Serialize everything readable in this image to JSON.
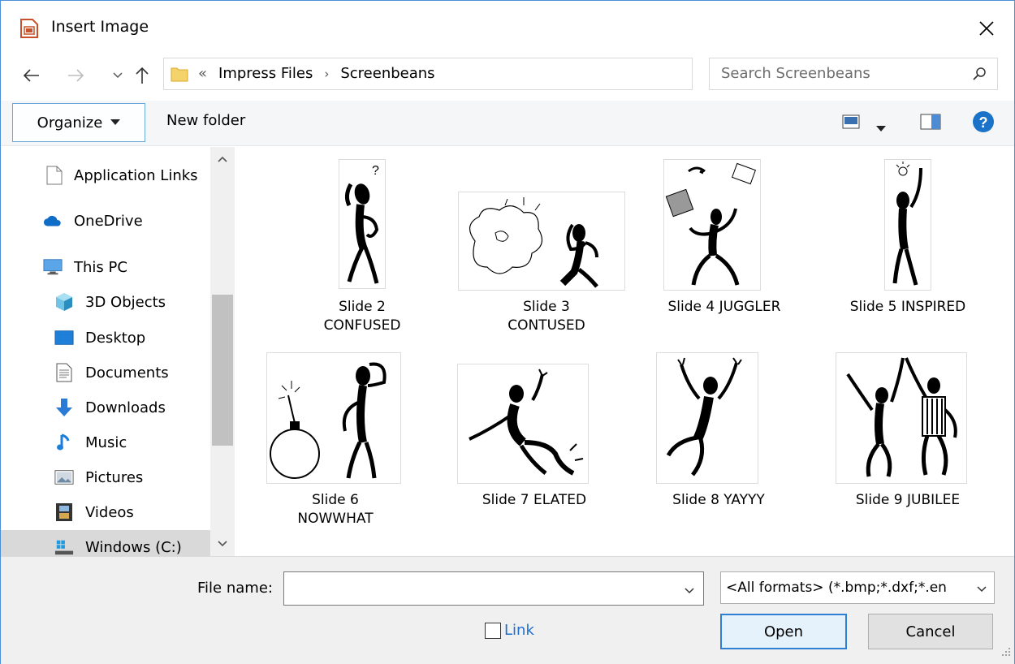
{
  "window": {
    "title": "Insert Image"
  },
  "address": {
    "overflow": "«",
    "crumbs": [
      "Impress Files",
      "Screenbeans"
    ]
  },
  "search": {
    "placeholder": "Search Screenbeans"
  },
  "toolbar": {
    "organize": "Organize",
    "new_folder": "New folder"
  },
  "sidebar": {
    "items": [
      {
        "label": "Application Links",
        "icon": "document-icon"
      },
      {
        "label": "OneDrive",
        "icon": "cloud-icon"
      },
      {
        "label": "This PC",
        "icon": "computer-icon"
      },
      {
        "label": "3D Objects",
        "icon": "cube-icon"
      },
      {
        "label": "Desktop",
        "icon": "desktop-icon"
      },
      {
        "label": "Documents",
        "icon": "documents-icon"
      },
      {
        "label": "Downloads",
        "icon": "download-arrow-icon"
      },
      {
        "label": "Music",
        "icon": "music-note-icon"
      },
      {
        "label": "Pictures",
        "icon": "pictures-icon"
      },
      {
        "label": "Videos",
        "icon": "film-icon"
      },
      {
        "label": "Windows (C:)",
        "icon": "drive-icon",
        "selected": true
      }
    ]
  },
  "files": [
    {
      "line1": "Slide 2",
      "line2": "CONFUSED"
    },
    {
      "line1": "Slide 3",
      "line2": "CONTUSED"
    },
    {
      "line1": "Slide 4 JUGGLER",
      "line2": ""
    },
    {
      "line1": "Slide 5 INSPIRED",
      "line2": ""
    },
    {
      "line1": "Slide 6",
      "line2": "NOWWHAT"
    },
    {
      "line1": "Slide 7 ELATED",
      "line2": ""
    },
    {
      "line1": "Slide 8 YAYYY",
      "line2": ""
    },
    {
      "line1": "Slide 9 JUBILEE",
      "line2": ""
    }
  ],
  "footer": {
    "file_name_label": "File name:",
    "file_name_value": "",
    "filter": "<All formats> (*.bmp;*.dxf;*.en",
    "link_label": "Link",
    "link_checked": false,
    "open": "Open",
    "cancel": "Cancel"
  },
  "colors": {
    "accent": "#2f7fd2",
    "help": "#1a73c8",
    "selected_bg": "#d9d9d9"
  }
}
